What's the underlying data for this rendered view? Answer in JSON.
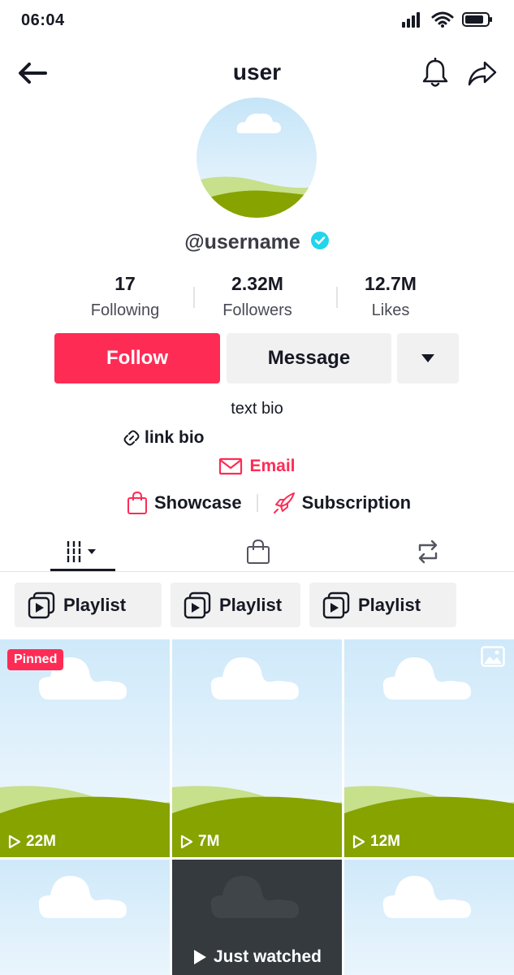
{
  "status_bar": {
    "time": "06:04"
  },
  "header": {
    "title": "user"
  },
  "profile": {
    "username": "@username",
    "verified": true
  },
  "stats": [
    {
      "value": "17",
      "label": "Following"
    },
    {
      "value": "2.32M",
      "label": "Followers"
    },
    {
      "value": "12.7M",
      "label": "Likes"
    }
  ],
  "actions": {
    "follow_label": "Follow",
    "message_label": "Message"
  },
  "bio": {
    "text": "text bio",
    "link": "link bio",
    "email": "Email",
    "showcase": "Showcase",
    "subscription": "Subscription"
  },
  "playlists": [
    {
      "label": "Playlist"
    },
    {
      "label": "Playlist"
    },
    {
      "label": "Playlist"
    }
  ],
  "videos": [
    {
      "views": "22M",
      "badge": "Pinned"
    },
    {
      "views": "7M"
    },
    {
      "views": "12M",
      "type": "photo"
    },
    {},
    {
      "label": "Just watched"
    },
    {}
  ],
  "colors": {
    "accent": "#fe2c55",
    "verified": "#20d5ec",
    "surface": "#f1f1f2",
    "sky": "#cfe9fa",
    "hill_light": "#c6e08c",
    "hill_dark": "#86a300"
  }
}
